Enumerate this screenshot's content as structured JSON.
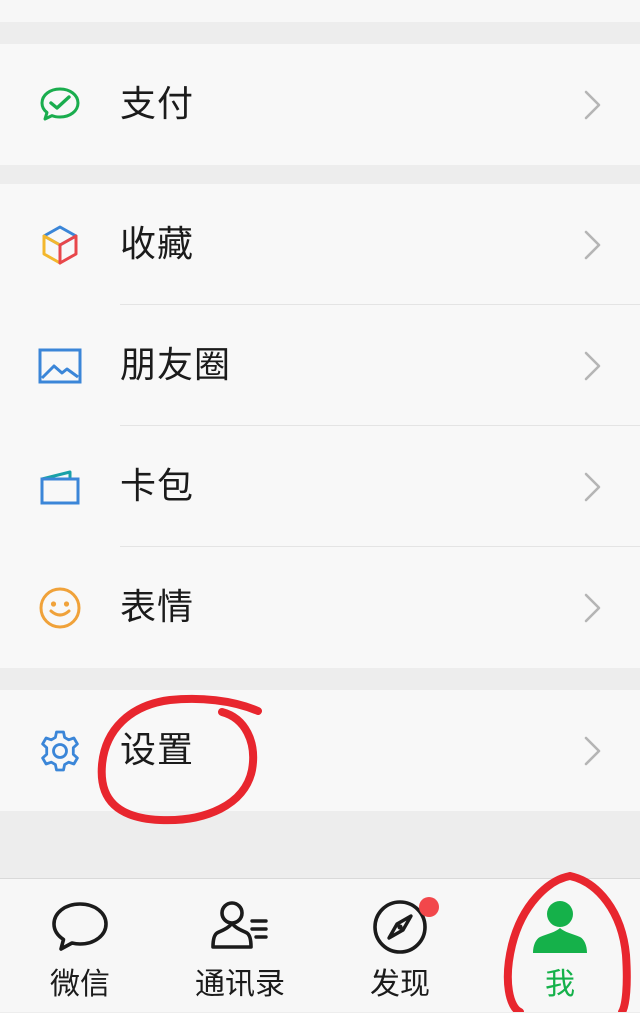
{
  "menu": {
    "pay": {
      "label": "支付",
      "icon": "wechat-pay-icon"
    },
    "favorites": {
      "label": "收藏",
      "icon": "cube-icon"
    },
    "moments": {
      "label": "朋友圈",
      "icon": "image-icon"
    },
    "cards": {
      "label": "卡包",
      "icon": "wallet-icon"
    },
    "stickers": {
      "label": "表情",
      "icon": "smiley-icon"
    },
    "settings": {
      "label": "设置",
      "icon": "gear-icon"
    }
  },
  "tabbar": {
    "chats": {
      "label": "微信",
      "icon": "chat-bubble-icon"
    },
    "contacts": {
      "label": "通讯录",
      "icon": "contacts-icon"
    },
    "discover": {
      "label": "发现",
      "icon": "compass-icon",
      "badge": "red-dot"
    },
    "me": {
      "label": "我",
      "icon": "person-icon",
      "active": true
    }
  },
  "colors": {
    "brand_green": "#15b14a",
    "annotation_red": "#e8262e",
    "badge_red": "#f2474b",
    "background": "#ededed",
    "cell": "#f8f8f8"
  }
}
